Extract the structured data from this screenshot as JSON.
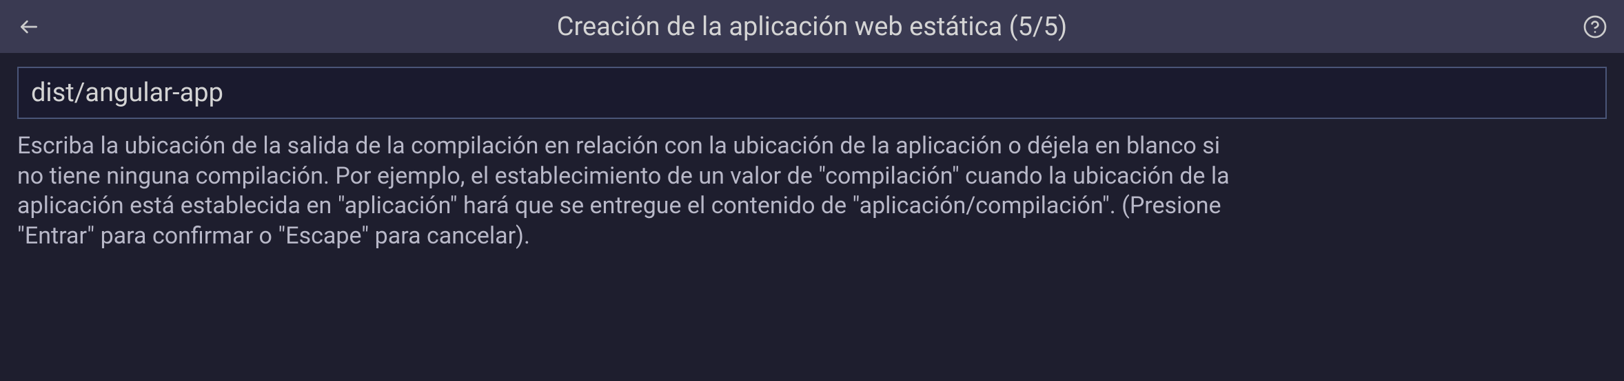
{
  "header": {
    "title": "Creación de la aplicación web estática (5/5)"
  },
  "input": {
    "value": "dist/angular-app",
    "placeholder": ""
  },
  "description": "Escriba la ubicación de la salida de la compilación en relación con la ubicación de la aplicación o déjela en blanco si no tiene ninguna compilación. Por ejemplo, el establecimiento de un valor de \"compilación\" cuando la ubicación de la aplicación está establecida en \"aplicación\" hará que se entregue el contenido de \"aplicación/compilación\". (Presione \"Entrar\" para confirmar o \"Escape\" para cancelar)."
}
